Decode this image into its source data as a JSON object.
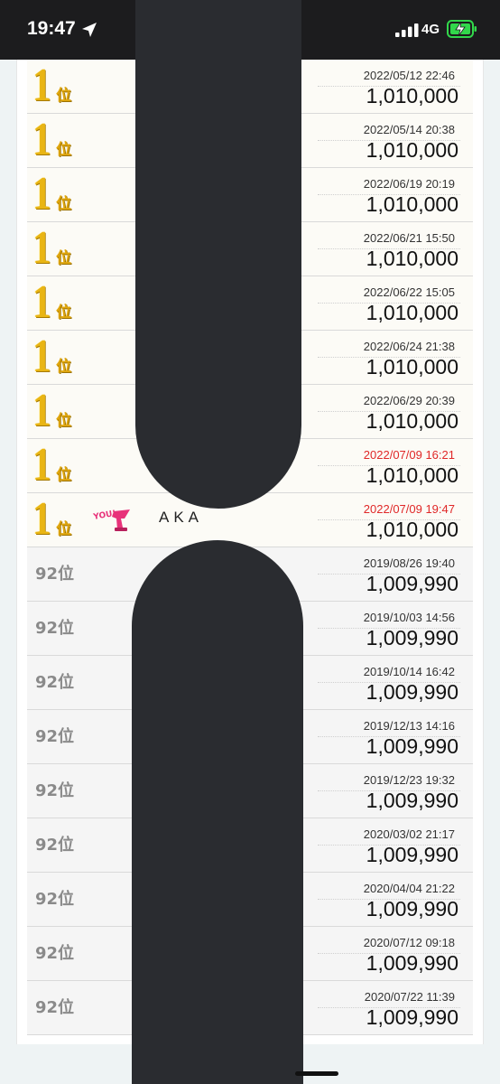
{
  "status_bar": {
    "time": "19:47",
    "network": "4G",
    "icons": [
      "location-arrow-icon",
      "cellular-signal-icon",
      "battery-charging-icon"
    ],
    "battery_color": "#32d74b"
  },
  "colors": {
    "gold_rank": "#e9b514",
    "gray_rank": "#8a8a8a",
    "highlight_date": "#e02828",
    "redaction": "#2a2c30"
  },
  "ranking": {
    "rows": [
      {
        "rank_num": "1",
        "rank_suffix": "位",
        "date": "2022/05/12 22:46",
        "score": "1,010,000",
        "tier": "gold"
      },
      {
        "rank_num": "1",
        "rank_suffix": "位",
        "date": "2022/05/14 20:38",
        "score": "1,010,000",
        "tier": "gold"
      },
      {
        "rank_num": "1",
        "rank_suffix": "位",
        "date": "2022/06/19 20:19",
        "score": "1,010,000",
        "tier": "gold"
      },
      {
        "rank_num": "1",
        "rank_suffix": "位",
        "date": "2022/06/21 15:50",
        "score": "1,010,000",
        "tier": "gold"
      },
      {
        "rank_num": "1",
        "rank_suffix": "位",
        "date": "2022/06/22 15:05",
        "score": "1,010,000",
        "tier": "gold"
      },
      {
        "rank_num": "1",
        "rank_suffix": "位",
        "date": "2022/06/24 21:38",
        "score": "1,010,000",
        "tier": "gold"
      },
      {
        "rank_num": "1",
        "rank_suffix": "位",
        "date": "2022/06/29 20:39",
        "score": "1,010,000",
        "tier": "gold"
      },
      {
        "rank_num": "1",
        "rank_suffix": "位",
        "date": "2022/07/09 16:21",
        "score": "1,010,000",
        "tier": "gold",
        "date_highlight": true
      },
      {
        "rank_num": "1",
        "rank_suffix": "位",
        "date": "2022/07/09 19:47",
        "score": "1,010,000",
        "tier": "gold",
        "date_highlight": true,
        "is_you": true,
        "badge": "YOU!",
        "player_name": "AKA"
      },
      {
        "rank_label": "92位",
        "date": "2019/08/26 19:40",
        "score": "1,009,990",
        "tier": "gray"
      },
      {
        "rank_label": "92位",
        "date": "2019/10/03 14:56",
        "score": "1,009,990",
        "tier": "gray"
      },
      {
        "rank_label": "92位",
        "date": "2019/10/14 16:42",
        "score": "1,009,990",
        "tier": "gray"
      },
      {
        "rank_label": "92位",
        "date": "2019/12/13 14:16",
        "score": "1,009,990",
        "tier": "gray"
      },
      {
        "rank_label": "92位",
        "date": "2019/12/23 19:32",
        "score": "1,009,990",
        "tier": "gray"
      },
      {
        "rank_label": "92位",
        "date": "2020/03/02 21:17",
        "score": "1,009,990",
        "tier": "gray"
      },
      {
        "rank_label": "92位",
        "date": "2020/04/04 21:22",
        "score": "1,009,990",
        "tier": "gray"
      },
      {
        "rank_label": "92位",
        "date": "2020/07/12 09:18",
        "score": "1,009,990",
        "tier": "gray"
      },
      {
        "rank_label": "92位",
        "date": "2020/07/22 11:39",
        "score": "1,009,990",
        "tier": "gray"
      }
    ]
  }
}
